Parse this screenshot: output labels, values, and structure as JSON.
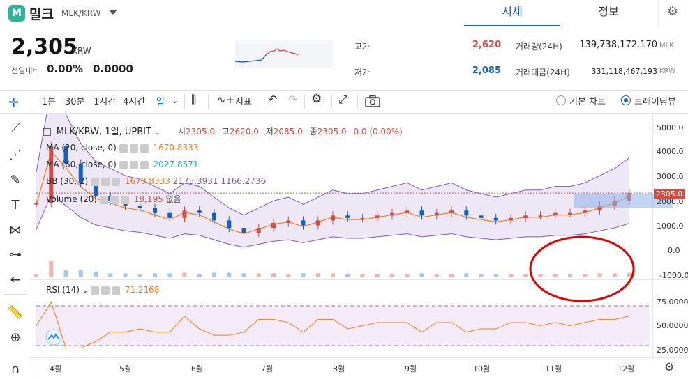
{
  "header": {
    "logo_letter": "M",
    "coin_name": "밀크",
    "pair": "MLK/KRW",
    "tabs": [
      "시세",
      "정보"
    ]
  },
  "ticker": {
    "price": "2,305",
    "unit": "KRW",
    "change_label": "전일대비",
    "change_rate": "0.00%",
    "change_amount": "0.0000",
    "high_label": "고가",
    "high": "2,620",
    "low_label": "저가",
    "low": "2,085",
    "volume_label": "거래량(24H)",
    "volume": "139,738,172.170",
    "volume_unit": "MLK",
    "amount_label": "거래대금(24H)",
    "amount": "331,118,467,193",
    "amount_unit": "KRW"
  },
  "toolbar": {
    "intervals": [
      "1분",
      "30분",
      "1시간",
      "4시간",
      "일"
    ],
    "indicator_label": "지표",
    "basic_chart": "기본 차트",
    "trading_view": "트레이딩뷰"
  },
  "legend": {
    "symbol": "MLK/KRW, 1일, UPBIT",
    "open_label": "시",
    "open": "2305.0",
    "high_label": "고",
    "high": "2620.0",
    "low_label": "저",
    "low": "2085.0",
    "close_label": "종",
    "close": "2305.0",
    "change": "0.0 (0.00%)",
    "ma1_label": "MA (20, close, 0)",
    "ma1_value": "1670.8333",
    "ma2_label": "MA (60, close, 0)",
    "ma2_value": "2027.8571",
    "bb_label": "BB (30, 2)",
    "bb_values": [
      "1670.8333",
      "2175.3931",
      "1166.2736"
    ],
    "vol_label": "Volume (20)",
    "vol_value": "18,195",
    "vol_extra": "없음",
    "rsi_label": "RSI (14)",
    "rsi_value": "71.2168"
  },
  "price_axis": {
    "labels": [
      "5000.0",
      "4000.0",
      "3000.0",
      "2000.0",
      "1000.0",
      "0.0",
      "-1000.0"
    ],
    "current": "2305.0"
  },
  "rsi_axis": {
    "labels": [
      "75.0000",
      "50.0000",
      "25.0000"
    ]
  },
  "time_axis": {
    "labels": [
      "4월",
      "5월",
      "6월",
      "7월",
      "8월",
      "9월",
      "10월",
      "11월",
      "12월"
    ]
  },
  "colors": {
    "up": "#d24f45",
    "down": "#1261c4",
    "accent": "#1761ce",
    "ma1": "#f57f17",
    "ma2": "#00bcd4",
    "bb": "#7e57c2",
    "rsi": "#f57f17"
  },
  "chart_data": {
    "type": "candlestick",
    "series": [
      {
        "name": "MLK/KRW price (approx. weekly closes)",
        "values": [
          1900,
          4200,
          3500,
          2700,
          2200,
          2000,
          1800,
          1700,
          1500,
          1300,
          1600,
          1500,
          1200,
          900,
          700,
          900,
          1100,
          1200,
          1000,
          1200,
          1400,
          1300,
          1300,
          1400,
          1500,
          1600,
          1400,
          1500,
          1600,
          1400,
          1300,
          1200,
          1300,
          1400,
          1400,
          1500,
          1500,
          1600,
          1800,
          2000,
          2300
        ]
      }
    ]
  }
}
